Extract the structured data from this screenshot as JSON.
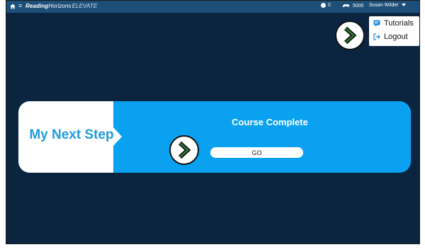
{
  "topbar": {
    "brand_bold": "Reading",
    "brand_main": "Horizons",
    "brand_sub": "ELEVATE",
    "stat_points": "0",
    "stat_coins": "5000",
    "user_name": "Susan Wilder"
  },
  "dropdown": {
    "tutorials_label": "Tutorials",
    "logout_label": "Logout"
  },
  "card": {
    "next_step_label": "My Next Step",
    "status_label": "Course Complete",
    "go_label": "GO"
  },
  "colors": {
    "background": "#0b2541",
    "topbar": "#1e4f79",
    "card_blue": "#0aa2f0",
    "next_step_text": "#1e9de0"
  },
  "icons": [
    "home-icon",
    "menu-icon",
    "points-icon",
    "coins-icon",
    "caret-down-icon",
    "tutorials-icon",
    "logout-icon",
    "chevron-right-icon"
  ]
}
